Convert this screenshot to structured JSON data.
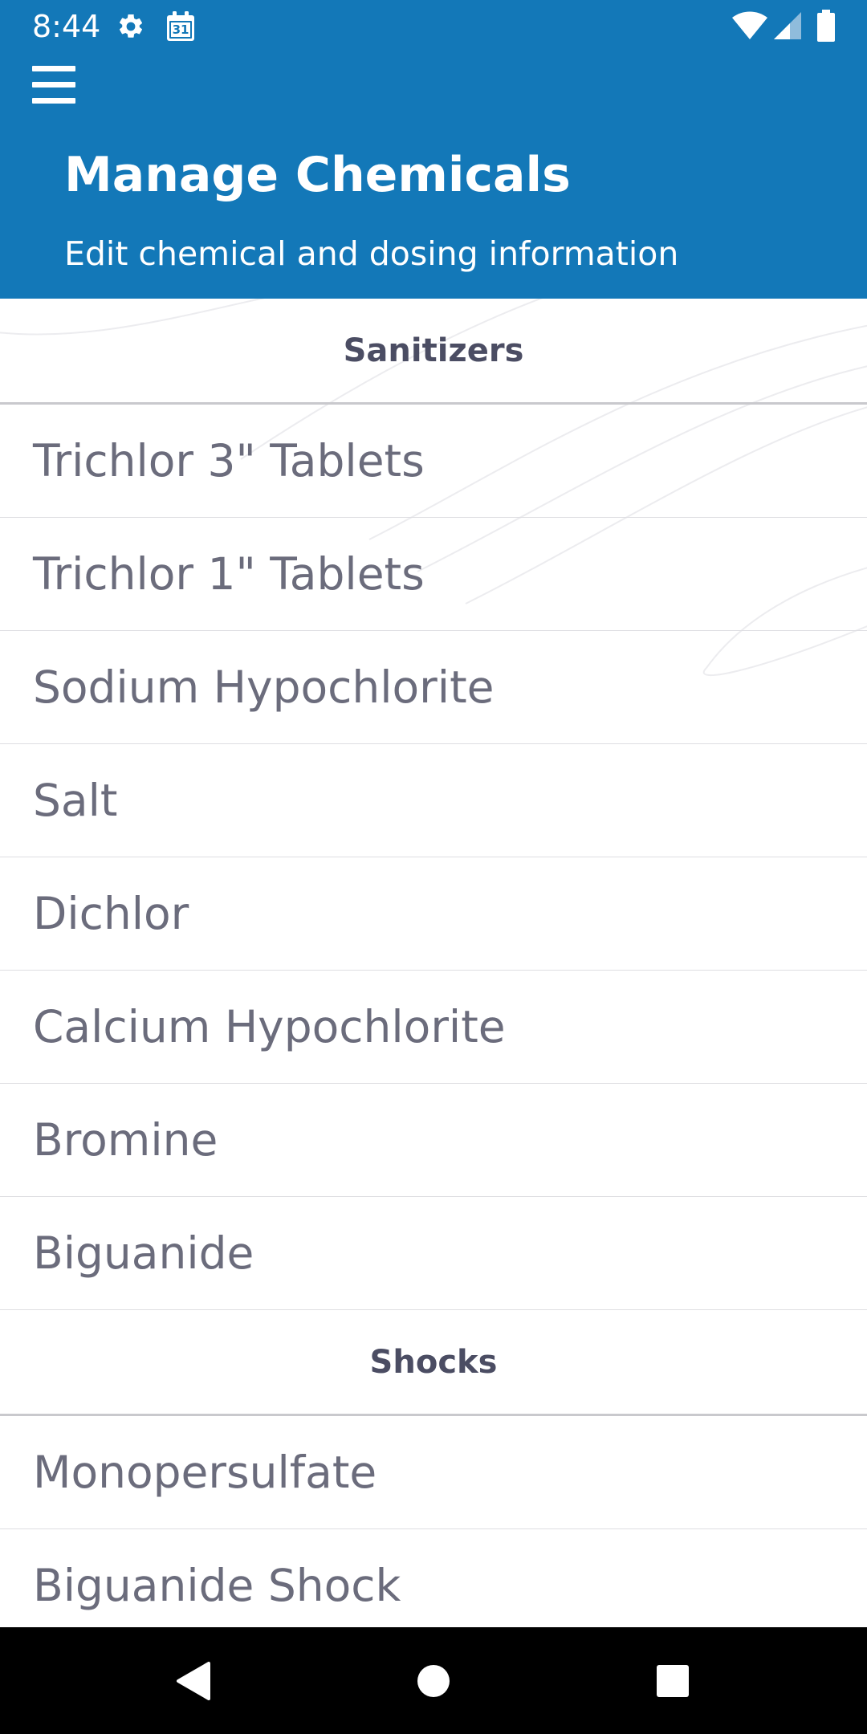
{
  "status_bar": {
    "time": "8:44",
    "left_icons": [
      "settings-gear-icon",
      "calendar-icon"
    ],
    "calendar_day": "31",
    "right_icons": [
      "wifi-icon",
      "cell-signal-icon",
      "battery-icon"
    ]
  },
  "header": {
    "menu_icon": "hamburger-menu-icon",
    "title": "Manage Chemicals",
    "subtitle": "Edit chemical and dosing information",
    "background_color": "#1378b8"
  },
  "sections": [
    {
      "title": "Sanitizers",
      "items": [
        "Trichlor 3\" Tablets",
        "Trichlor 1\" Tablets",
        "Sodium Hypochlorite",
        "Salt",
        "Dichlor",
        "Calcium Hypochlorite",
        "Bromine",
        "Biguanide"
      ]
    },
    {
      "title": "Shocks",
      "items": [
        "Monopersulfate",
        "Biguanide Shock"
      ]
    }
  ],
  "nav_bar": {
    "buttons": [
      "back-icon",
      "home-icon",
      "recents-icon"
    ]
  }
}
